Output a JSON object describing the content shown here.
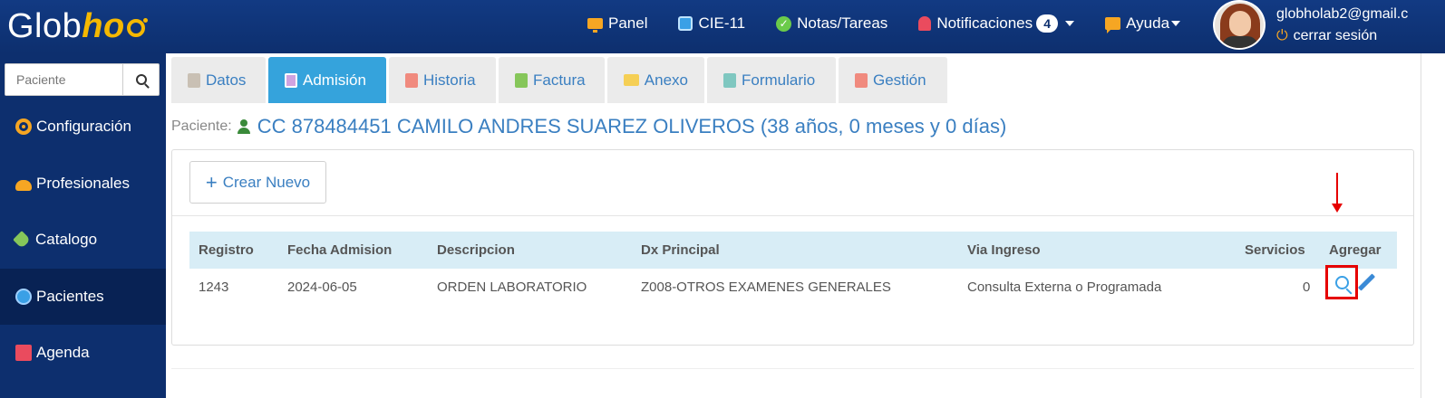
{
  "app": {
    "logo_text": "Glob",
    "logo_accent": "ho"
  },
  "topnav": {
    "panel": "Panel",
    "cie": "CIE-11",
    "notas": "Notas/Tareas",
    "notificaciones": "Notificaciones",
    "notif_count": "4",
    "ayuda": "Ayuda"
  },
  "user": {
    "email": "globholab2@gmail.c",
    "logout": "cerrar sesión"
  },
  "sidebar": {
    "search_placeholder": "Paciente",
    "items": [
      {
        "label": "Configuración",
        "icon": "gear-icon"
      },
      {
        "label": "Profesionales",
        "icon": "users-icon"
      },
      {
        "label": "Catalogo",
        "icon": "tag-icon"
      },
      {
        "label": "Pacientes",
        "icon": "user-circle-icon",
        "active": true
      },
      {
        "label": "Agenda",
        "icon": "calendar-icon"
      }
    ]
  },
  "tabs": [
    {
      "label": "Datos"
    },
    {
      "label": "Admisión",
      "active": true
    },
    {
      "label": "Historia"
    },
    {
      "label": "Factura"
    },
    {
      "label": "Anexo"
    },
    {
      "label": "Formulario"
    },
    {
      "label": "Gestión"
    }
  ],
  "patient": {
    "label": "Paciente:",
    "name": "CC 878484451 CAMILO ANDRES SUAREZ OLIVEROS (38 años, 0 meses y 0 días)"
  },
  "actions": {
    "create_new": "Crear Nuevo"
  },
  "table": {
    "headers": [
      "Registro",
      "Fecha Admision",
      "Descripcion",
      "Dx Principal",
      "Via Ingreso",
      "Servicios",
      "Agregar"
    ],
    "rows": [
      [
        "1243",
        "2024-06-05",
        "ORDEN LABORATORIO",
        "Z008-OTROS EXAMENES GENERALES",
        "Consulta Externa o Programada",
        "0"
      ]
    ]
  },
  "colors": {
    "topbar": "#0d2f6e",
    "active_tab": "#35a3dc",
    "link": "#3a7fc1",
    "table_header": "#d8edf6",
    "highlight": "#e60000"
  }
}
